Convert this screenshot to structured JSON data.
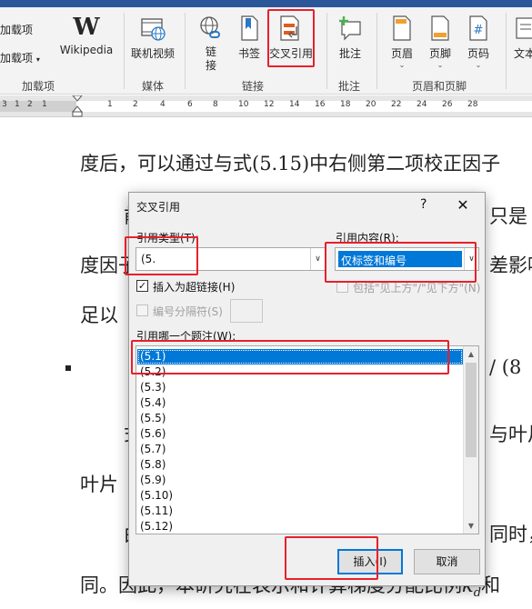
{
  "ribbon": {
    "addins": {
      "item1": "加载项",
      "item2": "加载项",
      "caret": "▾",
      "group": "加载项"
    },
    "wikipedia": {
      "label": "Wikipedia",
      "glyph": "W"
    },
    "media": {
      "online_video": "联机视频",
      "group": "媒体"
    },
    "links": {
      "link": "链接",
      "bookmark": "书签",
      "cross_ref": "交叉引用",
      "group": "链接"
    },
    "comments": {
      "comment": "批注",
      "group": "批注"
    },
    "header_footer": {
      "header": "页眉",
      "footer": "页脚",
      "page_number": "页码",
      "group": "页眉和页脚",
      "hash": "#"
    },
    "text": {
      "text_box": "文本"
    }
  },
  "ruler": {
    "numbers": [
      "3",
      "1",
      "2",
      "1",
      "1",
      "2",
      "4",
      "6",
      "8",
      "10",
      "12",
      "14",
      "16",
      "18",
      "20",
      "22",
      "24",
      "26",
      "28"
    ]
  },
  "document": {
    "lines": [
      "度后，可以通过与式(5.15)中右侧第二项校正因子",
      "前",
      "只是",
      "度因子",
      "差影响",
      "足以",
      "/ (8",
      "式",
      "与叶片",
      "叶片",
      "由",
      "同时，",
      "同。因此，本研究在表示和计算梯度分配比例",
      "和"
    ],
    "math_k": "k",
    "math_sub": "d"
  },
  "dialog": {
    "title": "交叉引用",
    "help": "?",
    "close": "✕",
    "ref_type_label": "引用类型(T):",
    "ref_type_value": "(5.",
    "ref_content_label": "引用内容(R):",
    "ref_content_value": "仅标签和编号",
    "insert_hyperlink_label": "插入为超链接(H)",
    "insert_hyperlink_checked": "✓",
    "include_above_below_label": "包括\"见上方\"/\"见下方\"(N)",
    "number_separator_label": "编号分隔符(S)",
    "which_caption_label": "引用哪一个题注(W):",
    "captions": [
      "(5.1)",
      "(5.2)",
      "(5.3)",
      "(5.4)",
      "(5.5)",
      "(5.6)",
      "(5.7)",
      "(5.8)",
      "(5.9)",
      "(5.10)",
      "(5.11)",
      "(5.12)"
    ],
    "drop_arrow": "∨",
    "scroll_up": "▲",
    "scroll_down": "▼",
    "insert_button": "插入(I)",
    "cancel_button": "取消"
  },
  "colors": {
    "highlight": "#e8202a",
    "selection": "#0078d7",
    "ribbon_bg": "#f3f3f3",
    "title_strip": "#2b579a"
  }
}
